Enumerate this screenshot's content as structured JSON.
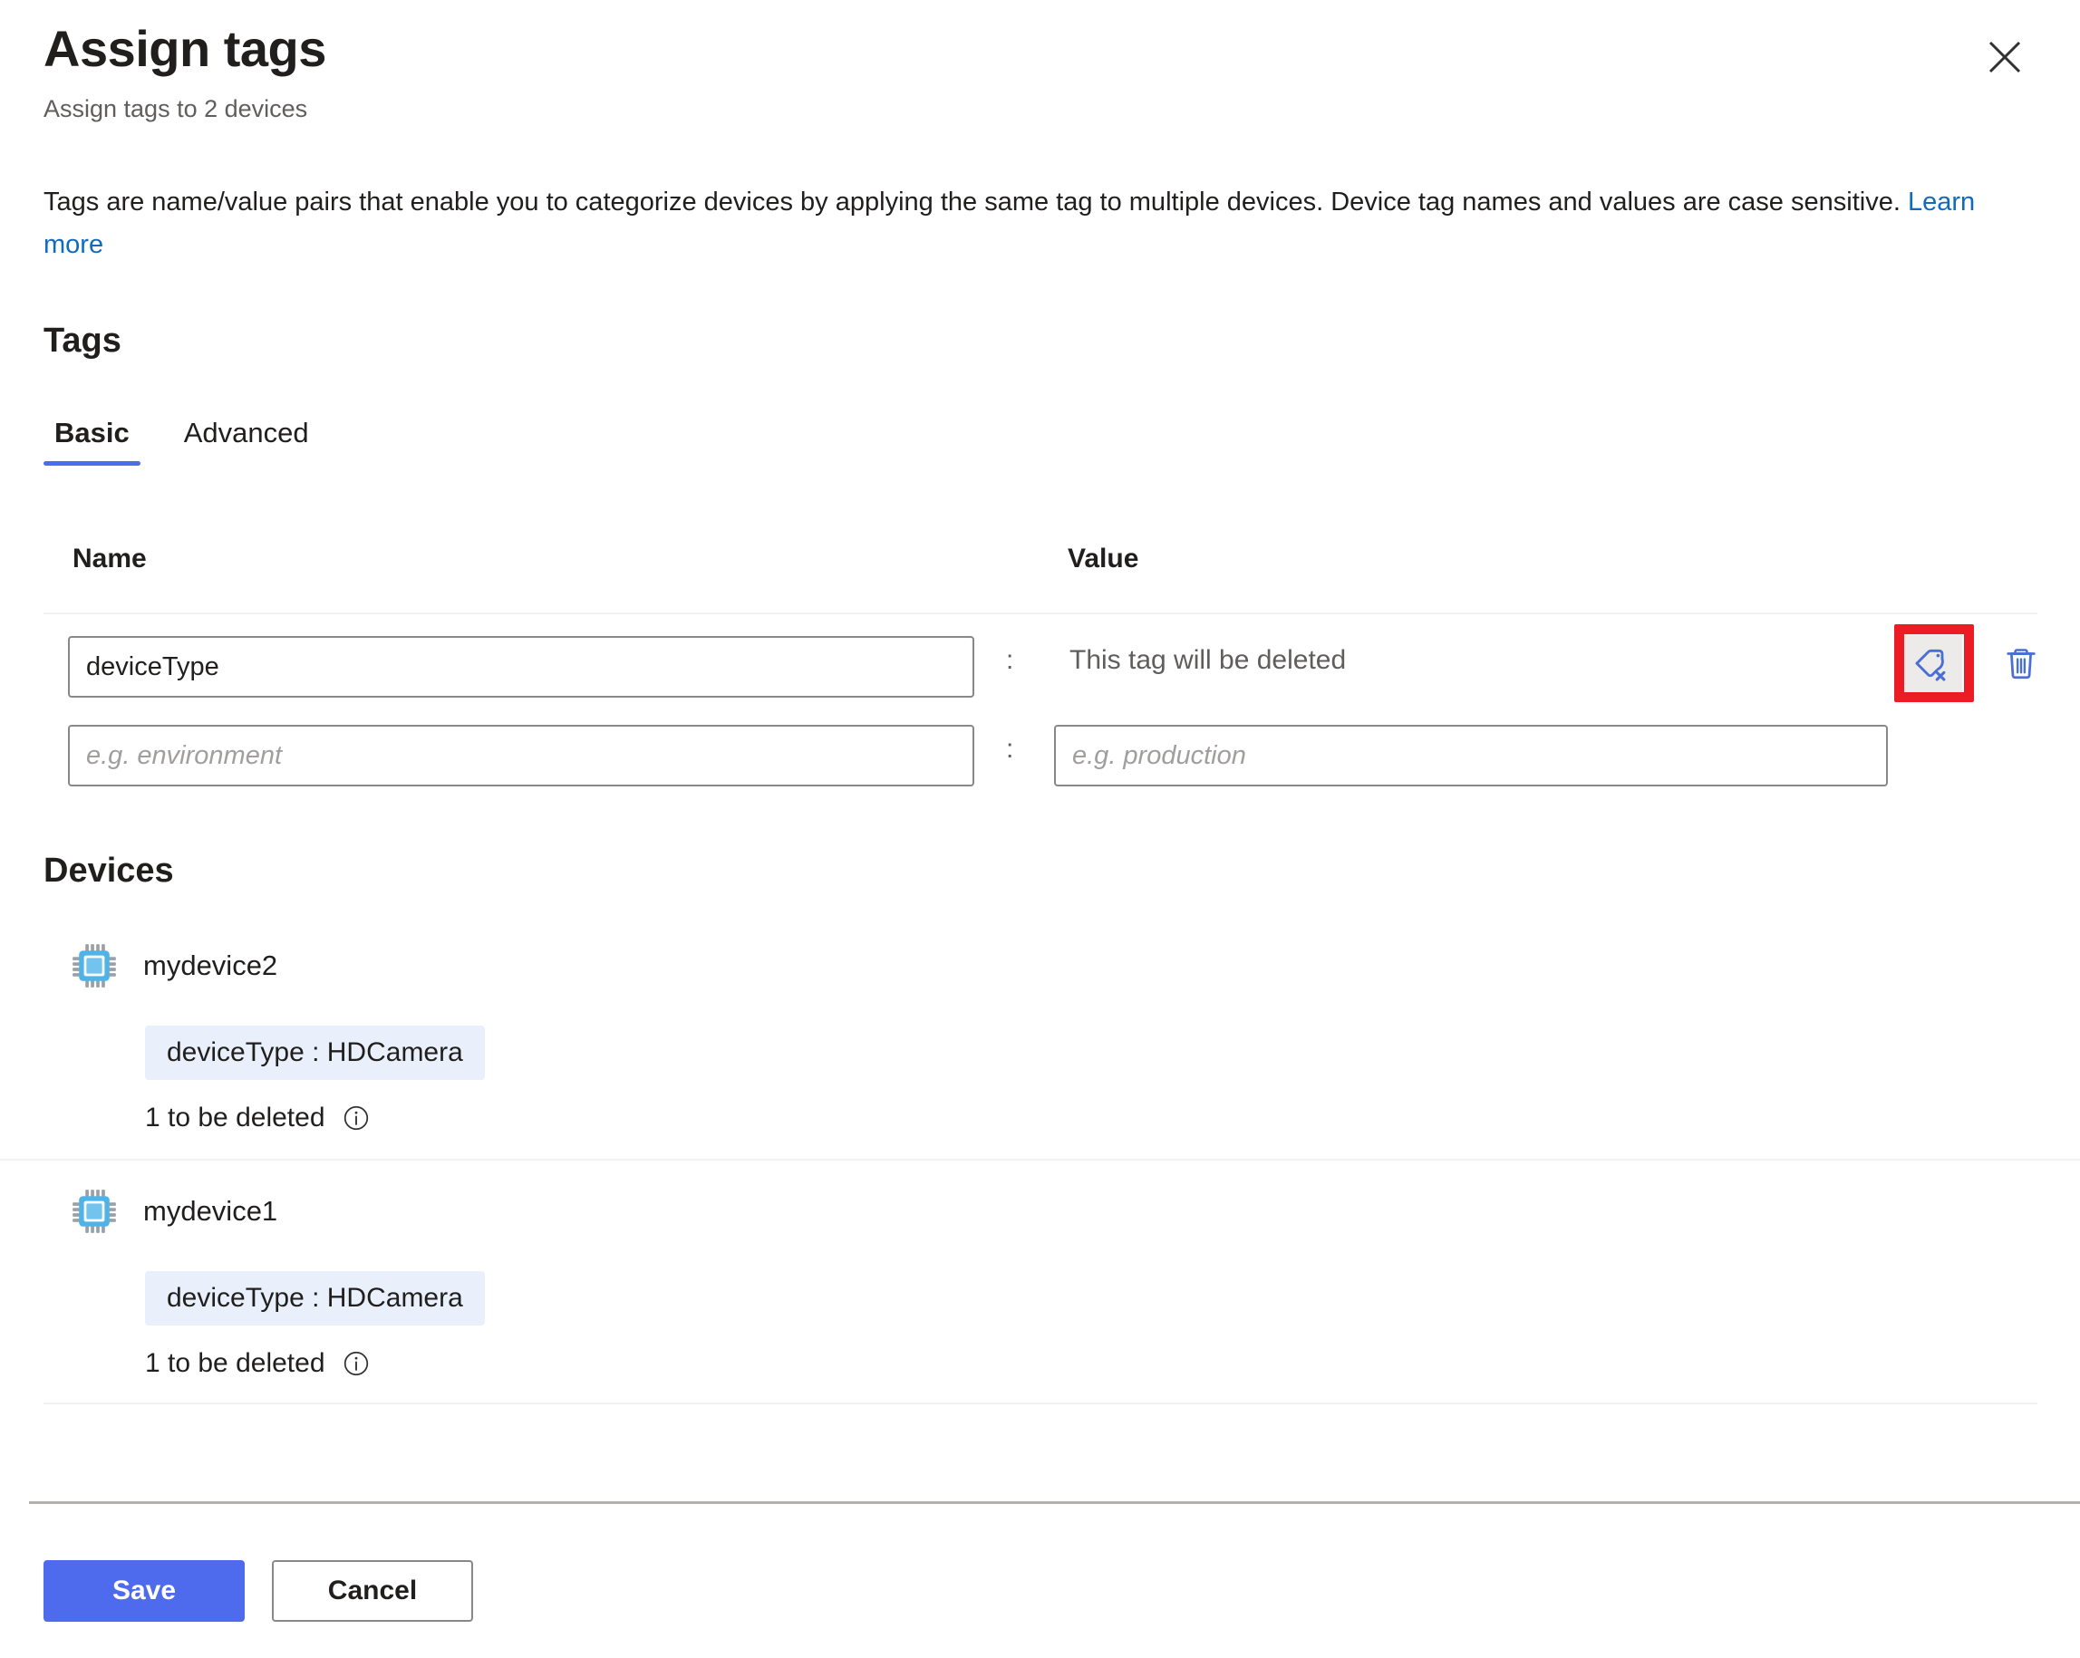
{
  "dialog": {
    "title": "Assign tags",
    "subtitle": "Assign tags to 2 devices",
    "close_icon": "close-icon",
    "description_text": "Tags are name/value pairs that enable you to categorize devices by applying the same tag to multiple devices. Device tag names and values are case sensitive.",
    "learn_more_label": "Learn more"
  },
  "tags_section": {
    "heading": "Tags",
    "tabs": [
      {
        "label": "Basic",
        "active": true
      },
      {
        "label": "Advanced",
        "active": false
      }
    ],
    "columns": {
      "name": "Name",
      "value": "Value"
    },
    "separator": ":",
    "rows": [
      {
        "name_value": "deviceType",
        "name_placeholder": "",
        "value_static_text": "This tag will be deleted",
        "has_value_input": false,
        "actions": [
          {
            "icon": "tag-remove-icon",
            "highlighted": true
          },
          {
            "icon": "trash-icon",
            "highlighted": false
          }
        ]
      },
      {
        "name_value": "",
        "name_placeholder": "e.g. environment",
        "value_value": "",
        "value_placeholder": "e.g. production",
        "has_value_input": true,
        "actions": []
      }
    ]
  },
  "devices_section": {
    "heading": "Devices",
    "items": [
      {
        "icon": "chip-icon",
        "name": "mydevice2",
        "tag_chip": "deviceType : HDCamera",
        "status": "1 to be deleted",
        "info_icon": "info-icon"
      },
      {
        "icon": "chip-icon",
        "name": "mydevice1",
        "tag_chip": "deviceType : HDCamera",
        "status": "1 to be deleted",
        "info_icon": "info-icon"
      }
    ]
  },
  "footer": {
    "save_label": "Save",
    "cancel_label": "Cancel"
  },
  "colors": {
    "accent": "#4f6bed",
    "link": "#0f6cbd",
    "icon_blue": "#4a6fd4",
    "highlight_red": "#ec1c24",
    "chip_bg": "#e9f0fb",
    "subtle_text": "#605e5c"
  }
}
